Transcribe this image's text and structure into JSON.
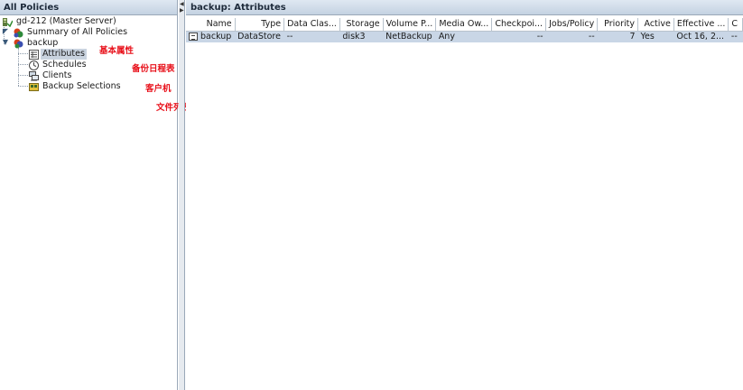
{
  "left_header": "All Policies",
  "tree": {
    "server": "gd-212 (Master Server)",
    "summary": "Summary of All Policies",
    "policy": "backup",
    "children": [
      "Attributes",
      "Schedules",
      "Clients",
      "Backup Selections"
    ]
  },
  "annotations": [
    "基本属性",
    "备份日程表",
    "客户机",
    "文件列表"
  ],
  "right_header": "backup: Attributes",
  "table": {
    "columns": [
      "Name",
      "Type",
      "Data Clas...",
      "Storage",
      "Volume P...",
      "Media Ow...",
      "Checkpoi...",
      "Jobs/Policy",
      "Priority",
      "Active",
      "Effective ...",
      "C"
    ],
    "row": [
      "backup",
      "DataStore",
      "--",
      "disk3",
      "NetBackup",
      "Any",
      "--",
      "--",
      "7",
      "Yes",
      "Oct 16, 2...",
      "--"
    ]
  },
  "icons": {
    "server": "server-icon",
    "summary": "summary-icon",
    "policy": "policy-icon",
    "attributes": "attributes-icon",
    "schedules": "schedules-icon",
    "clients": "clients-icon",
    "selections": "backup-selections-icon"
  },
  "colors": {
    "annotation": "#e8101a",
    "selection": "#c9d6e6",
    "header": "#c4d2e2"
  }
}
